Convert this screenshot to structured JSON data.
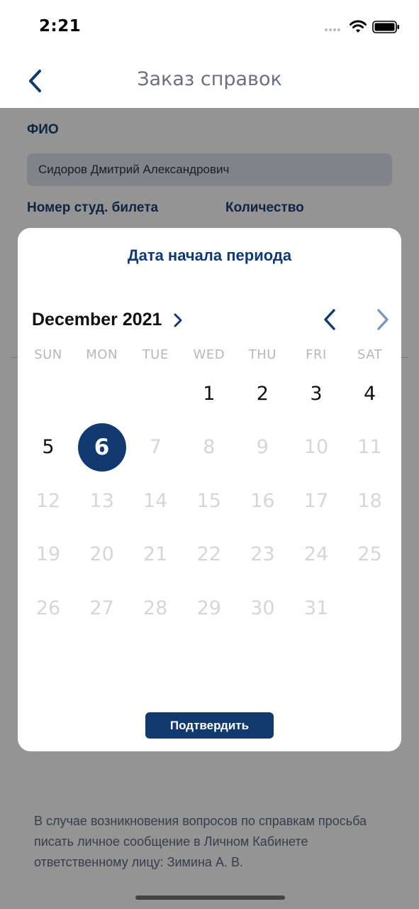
{
  "status_bar": {
    "time": "2:21"
  },
  "header": {
    "title": "Заказ справок",
    "back_icon": "chevron-left-icon"
  },
  "form": {
    "fio_label": "ФИО",
    "fio_value": "Сидоров Дмитрий Александрович",
    "student_id_label": "Номер студ. билета",
    "quantity_label": "Количество"
  },
  "footer_note": "В случае возникновения вопросов по справкам просьба писать личное сообщение в Личном Кабинете ответственному лицу: Зимина А. В.",
  "dialog": {
    "title": "Дата начала периода",
    "month_label": "December 2021",
    "weekdays": [
      "SUN",
      "MON",
      "TUE",
      "WED",
      "THU",
      "FRI",
      "SAT"
    ],
    "days": [
      {
        "d": "1",
        "state": "active"
      },
      {
        "d": "2",
        "state": "active"
      },
      {
        "d": "3",
        "state": "active"
      },
      {
        "d": "4",
        "state": "active"
      },
      {
        "d": "5",
        "state": "active"
      },
      {
        "d": "6",
        "state": "selected"
      },
      {
        "d": "7",
        "state": "disabled"
      },
      {
        "d": "8",
        "state": "disabled"
      },
      {
        "d": "9",
        "state": "disabled"
      },
      {
        "d": "10",
        "state": "disabled"
      },
      {
        "d": "11",
        "state": "disabled"
      },
      {
        "d": "12",
        "state": "disabled"
      },
      {
        "d": "13",
        "state": "disabled"
      },
      {
        "d": "14",
        "state": "disabled"
      },
      {
        "d": "15",
        "state": "disabled"
      },
      {
        "d": "16",
        "state": "disabled"
      },
      {
        "d": "17",
        "state": "disabled"
      },
      {
        "d": "18",
        "state": "disabled"
      },
      {
        "d": "19",
        "state": "disabled"
      },
      {
        "d": "20",
        "state": "disabled"
      },
      {
        "d": "21",
        "state": "disabled"
      },
      {
        "d": "22",
        "state": "disabled"
      },
      {
        "d": "23",
        "state": "disabled"
      },
      {
        "d": "24",
        "state": "disabled"
      },
      {
        "d": "25",
        "state": "disabled"
      },
      {
        "d": "26",
        "state": "disabled"
      },
      {
        "d": "27",
        "state": "disabled"
      },
      {
        "d": "28",
        "state": "disabled"
      },
      {
        "d": "29",
        "state": "disabled"
      },
      {
        "d": "30",
        "state": "disabled"
      },
      {
        "d": "31",
        "state": "disabled"
      }
    ],
    "confirm_label": "Подтвердить"
  },
  "colors": {
    "accent": "#123a70",
    "label": "#1d3f70",
    "nav_title": "#6b7080",
    "disabled_day": "#d6d6d6",
    "overlay": "rgba(0,0,0,0.42)"
  }
}
